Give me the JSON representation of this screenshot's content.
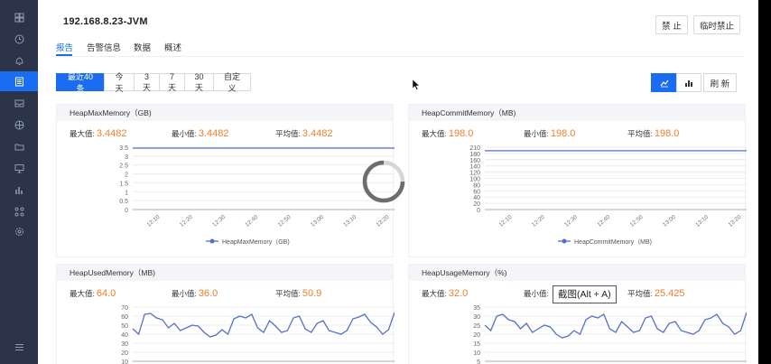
{
  "header": {
    "title": "192.168.8.23-JVM",
    "disable_label": "禁 止",
    "temp_disable_label": "临时禁止"
  },
  "tabs": [
    {
      "label": "报告",
      "active": true
    },
    {
      "label": "告警信息",
      "active": false
    },
    {
      "label": "数据",
      "active": false
    },
    {
      "label": "概述",
      "active": false
    }
  ],
  "ranges": [
    {
      "label": "最近40条",
      "active": true
    },
    {
      "label": "今天",
      "active": false
    },
    {
      "label": "3天",
      "active": false
    },
    {
      "label": "7天",
      "active": false
    },
    {
      "label": "30天",
      "active": false
    },
    {
      "label": "自定义",
      "active": false
    }
  ],
  "toolbar": {
    "line_view_icon": "line-chart-icon",
    "bar_view_icon": "bar-chart-icon",
    "refresh_label": "刷 新"
  },
  "sidebar": {
    "items": [
      {
        "icon": "grid-icon",
        "active": false
      },
      {
        "icon": "clock-icon",
        "active": false
      },
      {
        "icon": "bell-icon",
        "active": false
      },
      {
        "icon": "list-icon",
        "active": true
      },
      {
        "icon": "inbox-icon",
        "active": false
      },
      {
        "icon": "globe-icon",
        "active": false
      },
      {
        "icon": "folder-icon",
        "active": false
      },
      {
        "icon": "monitor-icon",
        "active": false
      },
      {
        "icon": "bar-chart-icon",
        "active": false
      },
      {
        "icon": "nodes-icon",
        "active": false
      },
      {
        "icon": "settings-icon",
        "active": false
      },
      {
        "icon": "menu-icon",
        "active": false
      }
    ]
  },
  "labels": {
    "max": "最大值:",
    "min": "最小值:",
    "avg": "平均值:"
  },
  "charts": [
    {
      "title": "HeapMaxMemory（GB)",
      "max": "3.4482",
      "min": "3.4482",
      "avg": "3.4482",
      "legend": "HeapMaxMemory（GB)"
    },
    {
      "title": "HeapCommitMemory（MB)",
      "max": "198.0",
      "min": "198.0",
      "avg": "198.0",
      "legend": "HeapCommitMemory（MB)"
    },
    {
      "title": "HeapUsedMemory（MB)",
      "max": "64.0",
      "min": "36.0",
      "avg": "50.9"
    },
    {
      "title": "HeapUsageMemory（%)",
      "max": "32.0",
      "min": "",
      "avg": "25.425"
    }
  ],
  "chart_data": [
    {
      "type": "line",
      "title": "HeapMaxMemory（GB)",
      "x": [
        "12:10",
        "12:20",
        "12:30",
        "12:40",
        "12:50",
        "13:00",
        "13:10",
        "13:20"
      ],
      "series": [
        {
          "name": "HeapMaxMemory（GB)",
          "values": [
            3.4482,
            3.4482,
            3.4482,
            3.4482,
            3.4482,
            3.4482,
            3.4482,
            3.4482
          ]
        }
      ],
      "yticks": [
        "3.5",
        "3",
        "2.5",
        "2",
        "1.5",
        "1",
        "0.5",
        "0"
      ],
      "ylim": [
        0,
        3.5
      ],
      "color": "#5470c6"
    },
    {
      "type": "line",
      "title": "HeapCommitMemory（MB)",
      "x": [
        "12:10",
        "12:20",
        "12:30",
        "12:40",
        "12:50",
        "13:00",
        "13:10",
        "13:20"
      ],
      "series": [
        {
          "name": "HeapCommitMemory（MB)",
          "values": [
            198,
            198,
            198,
            198,
            198,
            198,
            198,
            198
          ]
        }
      ],
      "yticks": [
        "210",
        "180",
        "160",
        "140",
        "120",
        "100",
        "80",
        "60",
        "40",
        "20",
        "0"
      ],
      "ylim": [
        0,
        210
      ],
      "color": "#5470c6"
    },
    {
      "type": "line",
      "title": "HeapUsedMemory（MB)",
      "series": [
        {
          "values": [
            46,
            40,
            62,
            63,
            58,
            56,
            47,
            52,
            44,
            47,
            50,
            49,
            42,
            37,
            39,
            45,
            40,
            57,
            60,
            58,
            62,
            47,
            42,
            55,
            49,
            42,
            44,
            58,
            60,
            46,
            42,
            52,
            55,
            44,
            42,
            40,
            44,
            57,
            59,
            62,
            53,
            48,
            40,
            45,
            64
          ]
        }
      ],
      "yticks": [
        "70",
        "60",
        "50",
        "40",
        "30",
        "20",
        "10"
      ],
      "ylim": [
        10,
        70
      ],
      "color": "#5470c6"
    },
    {
      "type": "line",
      "title": "HeapUsageMemory（%)",
      "series": [
        {
          "values": [
            25,
            22,
            30,
            31,
            28,
            27,
            23,
            26,
            21,
            23,
            25,
            24,
            20,
            18,
            19,
            22,
            20,
            28,
            30,
            29,
            31,
            23,
            21,
            27,
            24,
            21,
            22,
            29,
            30,
            23,
            21,
            26,
            27,
            22,
            21,
            20,
            22,
            28,
            29,
            31,
            26,
            24,
            20,
            22,
            32
          ]
        }
      ],
      "yticks": [
        "35",
        "30",
        "25",
        "20",
        "15",
        "10",
        "5"
      ],
      "ylim": [
        5,
        35
      ],
      "color": "#5470c6"
    }
  ],
  "tooltip": "截图(Alt + A)"
}
